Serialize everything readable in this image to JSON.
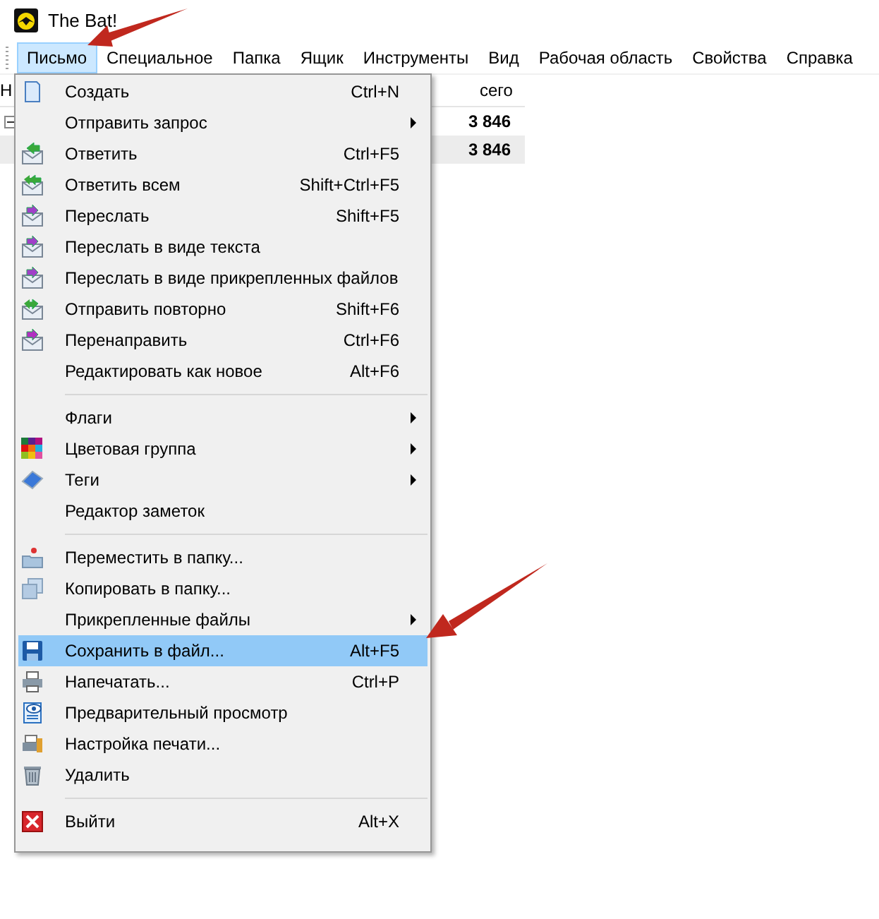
{
  "window": {
    "title": "The Bat!"
  },
  "menubar": [
    {
      "label": "Письмо",
      "selected": true
    },
    {
      "label": "Специальное",
      "selected": false
    },
    {
      "label": "Папка",
      "selected": false
    },
    {
      "label": "Ящик",
      "selected": false
    },
    {
      "label": "Инструменты",
      "selected": false
    },
    {
      "label": "Вид",
      "selected": false
    },
    {
      "label": "Рабочая область",
      "selected": false
    },
    {
      "label": "Свойства",
      "selected": false
    },
    {
      "label": "Справка",
      "selected": false
    }
  ],
  "list": {
    "columns": [
      "Н",
      "сего"
    ],
    "rows": [
      {
        "value": "3 846",
        "selected": false
      },
      {
        "value": "3 846",
        "selected": true
      }
    ]
  },
  "menu": {
    "items": [
      {
        "kind": "item",
        "label": "Создать",
        "shortcut": "Ctrl+N",
        "submenu": false,
        "selected": false
      },
      {
        "kind": "item",
        "label": "Отправить запрос",
        "submenu": true,
        "selected": false
      },
      {
        "kind": "item",
        "label": "Ответить",
        "shortcut": "Ctrl+F5",
        "submenu": false,
        "selected": false
      },
      {
        "kind": "item",
        "label": "Ответить всем",
        "shortcut": "Shift+Ctrl+F5",
        "submenu": false,
        "selected": false
      },
      {
        "kind": "item",
        "label": "Переслать",
        "shortcut": "Shift+F5",
        "submenu": false,
        "selected": false
      },
      {
        "kind": "item",
        "label": "Переслать в виде текста",
        "submenu": false,
        "selected": false
      },
      {
        "kind": "item",
        "label": "Переслать в виде прикрепленных файлов",
        "submenu": false,
        "selected": false
      },
      {
        "kind": "item",
        "label": "Отправить повторно",
        "shortcut": "Shift+F6",
        "submenu": false,
        "selected": false
      },
      {
        "kind": "item",
        "label": "Перенаправить",
        "shortcut": "Ctrl+F6",
        "submenu": false,
        "selected": false
      },
      {
        "kind": "item",
        "label": "Редактировать как новое",
        "shortcut": "Alt+F6",
        "submenu": false,
        "selected": false
      },
      {
        "kind": "separator"
      },
      {
        "kind": "item",
        "label": "Флаги",
        "submenu": true,
        "selected": false
      },
      {
        "kind": "item",
        "label": "Цветовая группа",
        "submenu": true,
        "selected": false
      },
      {
        "kind": "item",
        "label": "Теги",
        "submenu": true,
        "selected": false
      },
      {
        "kind": "item",
        "label": "Редактор заметок",
        "submenu": false,
        "selected": false
      },
      {
        "kind": "separator"
      },
      {
        "kind": "item",
        "label": "Переместить в папку...",
        "submenu": false,
        "selected": false
      },
      {
        "kind": "item",
        "label": "Копировать в папку...",
        "submenu": false,
        "selected": false
      },
      {
        "kind": "item",
        "label": "Прикрепленные файлы",
        "submenu": true,
        "selected": false
      },
      {
        "kind": "item",
        "label": "Сохранить в файл...",
        "shortcut": "Alt+F5",
        "submenu": false,
        "selected": true
      },
      {
        "kind": "item",
        "label": "Напечатать...",
        "shortcut": "Ctrl+P",
        "submenu": false,
        "selected": false
      },
      {
        "kind": "item",
        "label": "Предварительный просмотр",
        "submenu": false,
        "selected": false
      },
      {
        "kind": "item",
        "label": "Настройка печати...",
        "submenu": false,
        "selected": false
      },
      {
        "kind": "item",
        "label": "Удалить",
        "submenu": false,
        "selected": false
      },
      {
        "kind": "separator"
      },
      {
        "kind": "item",
        "label": "Выйти",
        "shortcut": "Alt+X",
        "submenu": false,
        "selected": false
      }
    ]
  }
}
